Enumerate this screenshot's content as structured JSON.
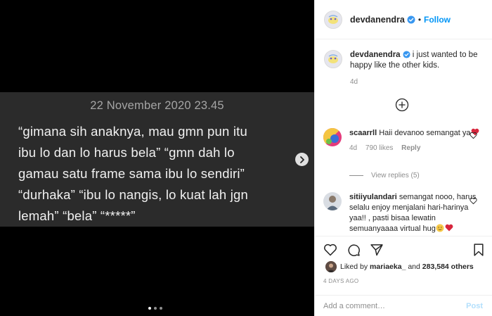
{
  "media": {
    "date_line": "22 November 2020 23.45",
    "lines": [
      "“gimana sih anaknya, mau gmn pun itu",
      "ibu lo dan lo harus bela” “gmn dah lo",
      "gamau satu frame sama ibu lo sendiri”",
      "“durhaka” “ibu lo nangis, lo kuat lah jgn",
      "lemah” “bela” “*****”"
    ],
    "next_icon": "chevron-right-icon",
    "carousel_position": 1,
    "carousel_count": 3
  },
  "header": {
    "username": "devdanendra",
    "verified_icon": "verified-badge-icon",
    "separator": "•",
    "follow_label": "Follow"
  },
  "caption": {
    "username": "devdanendra",
    "text": " i just wanted to be happy like the other kids.",
    "age": "4d"
  },
  "load_more_icon": "plus-circle-icon",
  "comments": [
    {
      "username": "scaarrll",
      "text": " Haii devanoo semangat ya",
      "age": "4d",
      "likes": "790 likes",
      "reply_label": "Reply",
      "view_replies": "View replies (5)"
    },
    {
      "username": "sitiiyulandari",
      "text": " semangat nooo, harus selalu enjoy menjalani hari-harinya yaa!! , pasti bisaa lewatin semuanyaaaa virtual hug"
    }
  ],
  "actions": {
    "liked_by_prefix": "Liked by ",
    "liked_by_user": "mariaeka_",
    "liked_by_and": " and ",
    "liked_by_count": "283,584 others",
    "timestamp": "4 DAYS AGO",
    "comment_placeholder": "Add a comment…",
    "post_label": "Post"
  },
  "colors": {
    "accent": "#0095f6",
    "heart": "#ed4956",
    "media_panel": "#2b2b2b"
  }
}
